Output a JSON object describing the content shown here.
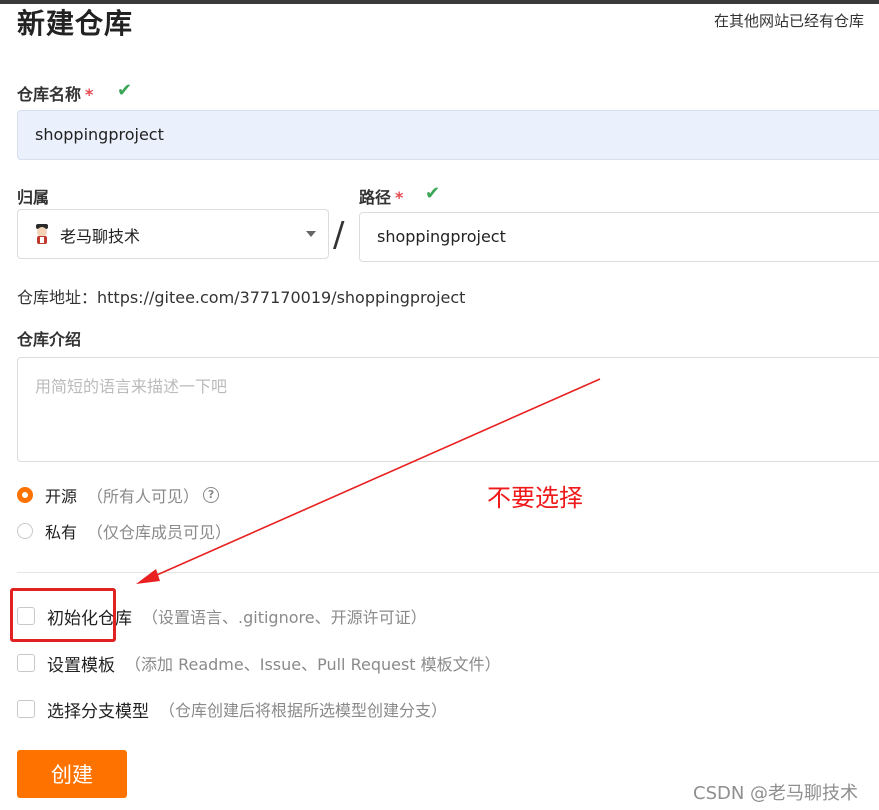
{
  "page": {
    "title": "新建仓库",
    "import_link": "在其他网站已经有仓库"
  },
  "repo_name": {
    "label": "仓库名称",
    "required_mark": "*",
    "value": "shoppingproject",
    "valid_icon": "check-icon"
  },
  "owner": {
    "label": "归属",
    "value": "老马聊技术",
    "avatar_icon": "user-avatar-icon"
  },
  "separator": "/",
  "path": {
    "label": "路径",
    "required_mark": "*",
    "value": "shoppingproject",
    "valid_icon": "check-icon"
  },
  "repo_address": "仓库地址：https://gitee.com/377170019/shoppingproject",
  "description": {
    "label": "仓库介绍",
    "placeholder": "用简短的语言来描述一下吧"
  },
  "visibility": {
    "selected": "public",
    "public_label": "开源",
    "public_desc": "（所有人可见）",
    "help_icon": "question-circle-icon",
    "private_label": "私有",
    "private_desc": "（仅仓库成员可见）"
  },
  "options": [
    {
      "label": "初始化仓库",
      "desc": "（设置语言、.gitignore、开源许可证）",
      "checked": false
    },
    {
      "label": "设置模板",
      "desc": "（添加 Readme、Issue、Pull Request 模板文件）",
      "checked": false
    },
    {
      "label": "选择分支模型",
      "desc": "（仓库创建后将根据所选模型创建分支）",
      "checked": false
    }
  ],
  "annotation": "不要选择",
  "create_button": "创建",
  "watermark": "CSDN @老马聊技术",
  "colors": {
    "accent": "#fe7300",
    "valid": "#3aa655",
    "annotation": "#f01818",
    "input_filled_bg": "#eaf1fc"
  }
}
